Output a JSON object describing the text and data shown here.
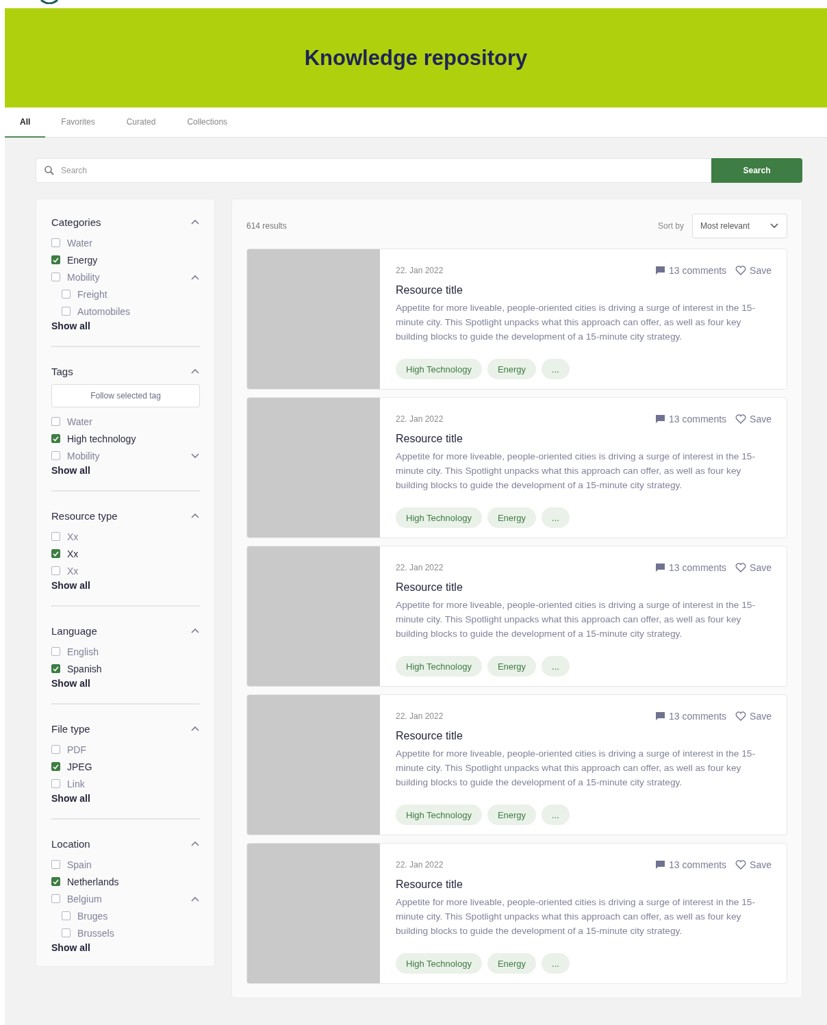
{
  "header": {
    "title": "Knowledge repository"
  },
  "tabs": [
    {
      "label": "All",
      "selected": true
    },
    {
      "label": "Favorites",
      "selected": false
    },
    {
      "label": "Curated",
      "selected": false
    },
    {
      "label": "Collections",
      "selected": false
    }
  ],
  "search": {
    "placeholder": "Search",
    "button": "Search"
  },
  "filters": [
    {
      "title": "Categories",
      "expanded": true,
      "items": [
        {
          "label": "Water",
          "checked": false
        },
        {
          "label": "Energy",
          "checked": true
        },
        {
          "label": "Mobility",
          "checked": false,
          "expanded": true,
          "children": [
            {
              "label": "Freight",
              "checked": false
            },
            {
              "label": "Automobiles",
              "checked": false
            }
          ]
        }
      ],
      "show_all": "Show all"
    },
    {
      "title": "Tags",
      "expanded": true,
      "button": "Follow selected tag",
      "items": [
        {
          "label": "Water",
          "checked": false
        },
        {
          "label": "High technology",
          "checked": true
        },
        {
          "label": "Mobility",
          "checked": false,
          "expanded": false
        }
      ],
      "show_all": "Show all"
    },
    {
      "title": "Resource type",
      "expanded": true,
      "items": [
        {
          "label": "Xx",
          "checked": false
        },
        {
          "label": "Xx",
          "checked": true
        },
        {
          "label": "Xx",
          "checked": false
        }
      ],
      "show_all": "Show all"
    },
    {
      "title": "Language",
      "expanded": true,
      "items": [
        {
          "label": "English",
          "checked": false
        },
        {
          "label": "Spanish",
          "checked": true
        }
      ],
      "show_all": "Show all"
    },
    {
      "title": "File type",
      "expanded": true,
      "items": [
        {
          "label": "PDF",
          "checked": false
        },
        {
          "label": "JPEG",
          "checked": true
        },
        {
          "label": "Link",
          "checked": false
        }
      ],
      "show_all": "Show all"
    },
    {
      "title": "Location",
      "expanded": true,
      "items": [
        {
          "label": "Spain",
          "checked": false
        },
        {
          "label": "Netherlands",
          "checked": true
        },
        {
          "label": "Belgium",
          "checked": false,
          "expanded": true,
          "children": [
            {
              "label": "Bruges",
              "checked": false
            },
            {
              "label": "Brussels",
              "checked": false
            }
          ]
        }
      ],
      "show_all": "Show all"
    }
  ],
  "results": {
    "count": "614 results",
    "sort_label": "Sort by",
    "sort_value": "Most relevant",
    "items": [
      {
        "date": "22. Jan 2022",
        "comments": "13 comments",
        "save": "Save",
        "title": "Resource title",
        "description": "Appetite for more liveable, people-oriented cities is driving a surge of interest in the 15-minute city. This Spotlight unpacks what this approach can offer, as well as four key building blocks to guide the development of a 15-minute city strategy.",
        "tags": [
          "High Technology",
          "Energy",
          "..."
        ]
      },
      {
        "date": "22. Jan 2022",
        "comments": "13 comments",
        "save": "Save",
        "title": "Resource title",
        "description": "Appetite for more liveable, people-oriented cities is driving a surge of interest in the 15-minute city. This Spotlight unpacks what this approach can offer, as well as four key building blocks to guide the development of a 15-minute city strategy.",
        "tags": [
          "High Technology",
          "Energy",
          "..."
        ]
      },
      {
        "date": "22. Jan 2022",
        "comments": "13 comments",
        "save": "Save",
        "title": "Resource title",
        "description": "Appetite for more liveable, people-oriented cities is driving a surge of interest in the 15-minute city. This Spotlight unpacks what this approach can offer, as well as four key building blocks to guide the development of a 15-minute city strategy.",
        "tags": [
          "High Technology",
          "Energy",
          "..."
        ]
      },
      {
        "date": "22. Jan 2022",
        "comments": "13 comments",
        "save": "Save",
        "title": "Resource title",
        "description": "Appetite for more liveable, people-oriented cities is driving a surge of interest in the 15-minute city. This Spotlight unpacks what this approach can offer, as well as four key building blocks to guide the development of a 15-minute city strategy.",
        "tags": [
          "High Technology",
          "Energy",
          "..."
        ]
      },
      {
        "date": "22. Jan 2022",
        "comments": "13 comments",
        "save": "Save",
        "title": "Resource title",
        "description": "Appetite for more liveable, people-oriented cities is driving a surge of interest in the 15-minute city. This Spotlight unpacks what this approach can offer, as well as four key building blocks to guide the development of a 15-minute city strategy.",
        "tags": [
          "High Technology",
          "Energy",
          "..."
        ]
      }
    ]
  }
}
